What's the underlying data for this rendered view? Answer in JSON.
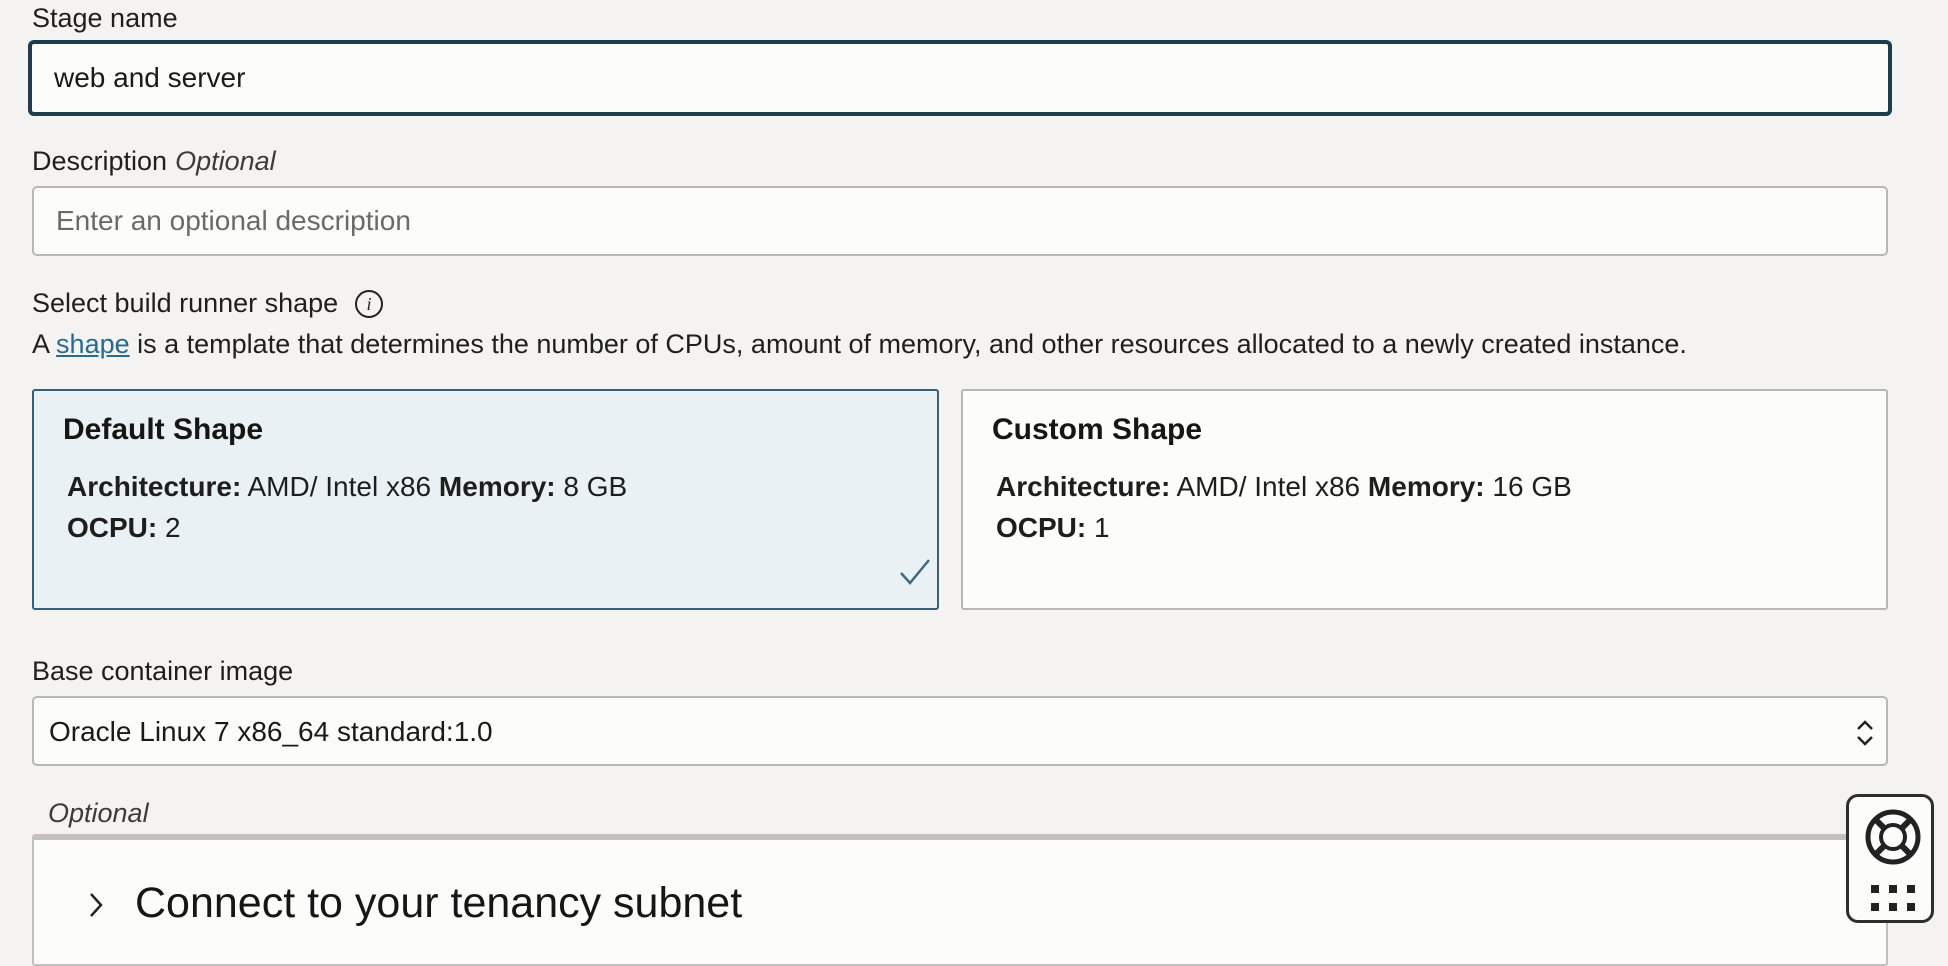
{
  "stage_name": {
    "label": "Stage name",
    "value": "web and server"
  },
  "description": {
    "label": "Description",
    "optional_tag": "Optional",
    "placeholder": "Enter an optional description"
  },
  "shape": {
    "heading": "Select build runner shape",
    "info_icon": "info-icon",
    "help_prefix": "A",
    "help_link": "shape",
    "help_suffix": "is a template that determines the number of CPUs, amount of memory, and other resources allocated to a newly created instance.",
    "cards": [
      {
        "title": "Default Shape",
        "arch_label": "Architecture:",
        "arch_value": "AMD/ Intel x86",
        "mem_label": "Memory:",
        "mem_value": "8 GB",
        "ocpu_label": "OCPU:",
        "ocpu_value": "2",
        "selected": true
      },
      {
        "title": "Custom Shape",
        "arch_label": "Architecture:",
        "arch_value": "AMD/ Intel x86",
        "mem_label": "Memory:",
        "mem_value": "16 GB",
        "ocpu_label": "OCPU:",
        "ocpu_value": "1",
        "selected": false
      }
    ]
  },
  "base_image": {
    "label": "Base container image",
    "selected": "Oracle Linux 7 x86_64 standard:1.0"
  },
  "subnet": {
    "optional_tag": "Optional",
    "title": "Connect to your tenancy subnet"
  },
  "icons": {
    "check": "checkmark-icon",
    "select_arrows": "chevron-up-down-icon",
    "expand": "chevron-right-icon",
    "help": "lifebuoy-icon",
    "apps": "grid-dots-icon"
  },
  "colors": {
    "focus_border": "#1d3d4e",
    "selected_bg": "#eaf1f4",
    "selected_border": "#3a5e76",
    "link": "#2a6a8e",
    "page_bg": "#f4f3f2"
  }
}
